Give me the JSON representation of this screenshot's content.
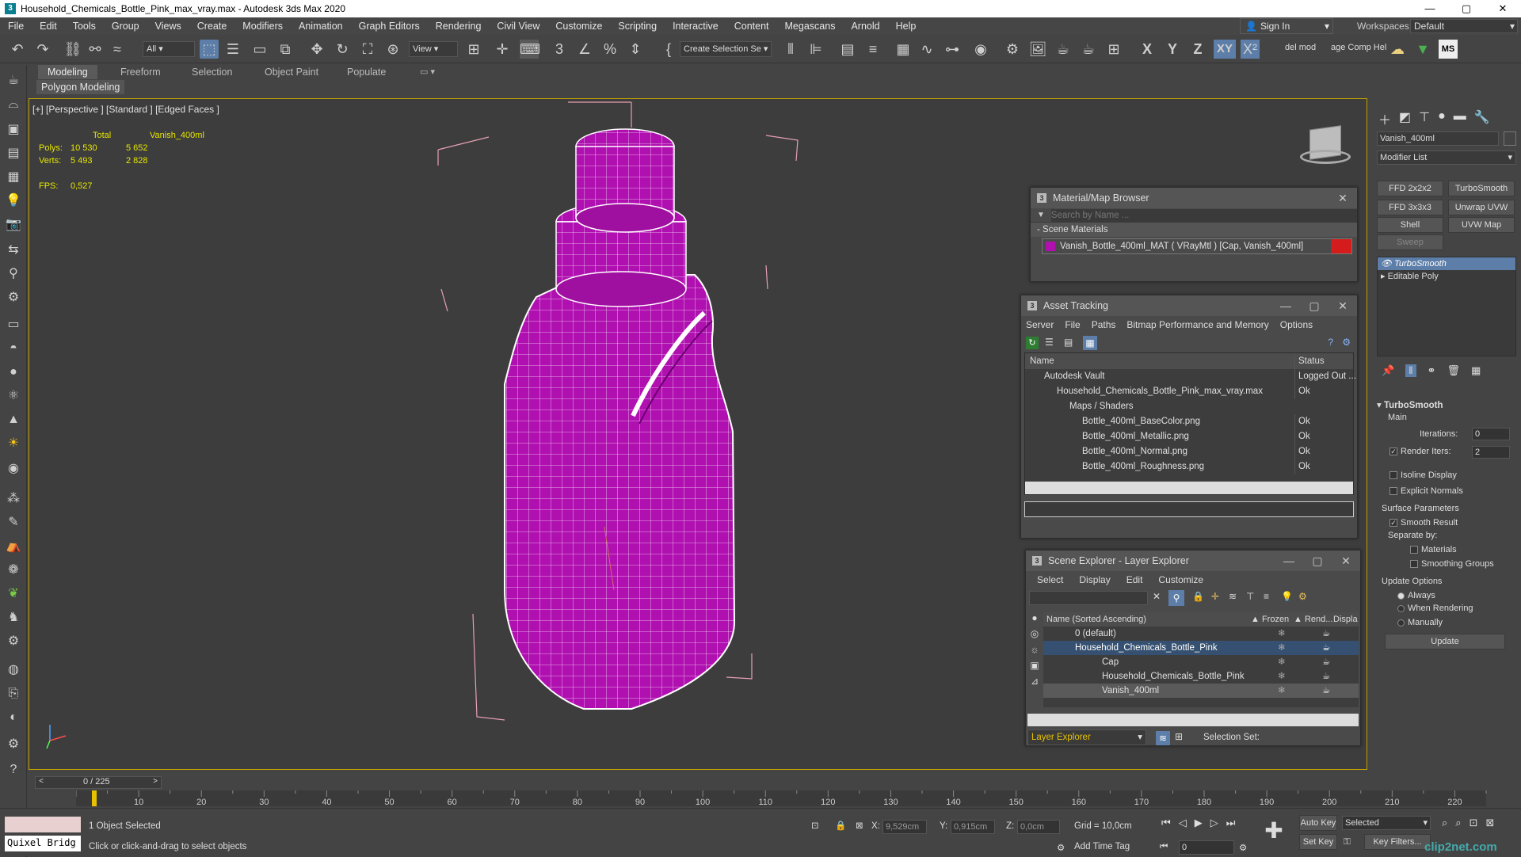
{
  "title_bar": {
    "title": "Household_Chemicals_Bottle_Pink_max_vray.max - Autodesk 3ds Max 2020",
    "minimize": "—",
    "maximize": "▢",
    "close": "✕"
  },
  "menu": {
    "items": [
      "File",
      "Edit",
      "Tools",
      "Group",
      "Views",
      "Create",
      "Modifiers",
      "Animation",
      "Graph Editors",
      "Rendering",
      "Civil View",
      "Customize",
      "Scripting",
      "Interactive",
      "Content",
      "Megascans",
      "Arnold",
      "Help"
    ],
    "sign_in": "Sign In",
    "workspaces_label": "Workspaces:",
    "workspaces_value": "Default"
  },
  "toolbar": {
    "filter_value": "All",
    "view_value": "View",
    "create_selection_set": "Create Selection Se",
    "axis_x": "X",
    "axis_y": "Y",
    "axis_z": "Z",
    "axis_xy": "XY",
    "del_mod": "del mod",
    "age_comp_help": "age Comp Hel",
    "ms": "MS"
  },
  "ribbon": {
    "tabs": [
      "Modeling",
      "Freeform",
      "Selection",
      "Object Paint",
      "Populate"
    ],
    "active_sub": "Polygon Modeling"
  },
  "viewport": {
    "label": "[+] [Perspective ] [Standard ] [Edged Faces ]",
    "stats": {
      "total_label": "Total",
      "object_label": "Vanish_400ml",
      "polys_label": "Polys:",
      "polys_total": "10 530",
      "polys_object": "5 652",
      "verts_label": "Verts:",
      "verts_total": "5 493",
      "verts_object": "2 828",
      "fps_label": "FPS:",
      "fps_value": "0,527"
    }
  },
  "material_browser": {
    "title": "Material/Map Browser",
    "search_placeholder": "Search by Name ...",
    "section": "- Scene Materials",
    "material_item": "Vanish_Bottle_400ml_MAT  ( VRayMtl ) [Cap, Vanish_400ml]"
  },
  "asset_tracking": {
    "title": "Asset Tracking",
    "menu": [
      "Server",
      "File",
      "Paths",
      "Bitmap Performance and Memory",
      "Options"
    ],
    "col_name": "Name",
    "col_status": "Status",
    "rows": [
      {
        "name": "Autodesk Vault",
        "status": "Logged Out ..."
      },
      {
        "name": "Household_Chemicals_Bottle_Pink_max_vray.max",
        "status": "Ok"
      },
      {
        "name": "Maps / Shaders",
        "status": ""
      },
      {
        "name": "Bottle_400ml_BaseColor.png",
        "status": "Ok"
      },
      {
        "name": "Bottle_400ml_Metallic.png",
        "status": "Ok"
      },
      {
        "name": "Bottle_400ml_Normal.png",
        "status": "Ok"
      },
      {
        "name": "Bottle_400ml_Roughness.png",
        "status": "Ok"
      }
    ]
  },
  "scene_explorer": {
    "title": "Scene Explorer - Layer Explorer",
    "menu": [
      "Select",
      "Display",
      "Edit",
      "Customize"
    ],
    "col_name": "Name (Sorted Ascending)",
    "col_frozen": "▲ Frozen",
    "col_render": "▲ Rend...",
    "col_display": "Displa",
    "rows": [
      {
        "name": "0 (default)"
      },
      {
        "name": "Household_Chemicals_Bottle_Pink"
      },
      {
        "name": "Cap"
      },
      {
        "name": "Household_Chemicals_Bottle_Pink"
      },
      {
        "name": "Vanish_400ml"
      }
    ],
    "footer_value": "Layer Explorer",
    "selection_set_label": "Selection Set:"
  },
  "command_panel": {
    "object_name": "Vanish_400ml",
    "modifier_list": "Modifier List",
    "buttons": [
      "FFD 2x2x2",
      "TurboSmooth",
      "FFD 3x3x3",
      "Unwrap UVW",
      "Shell",
      "UVW Map",
      "Sweep"
    ],
    "stack": [
      "TurboSmooth",
      "Editable Poly"
    ],
    "rollout_title": "TurboSmooth",
    "main_label": "Main",
    "iterations_label": "Iterations:",
    "iterations_value": "0",
    "render_iters_label": "Render Iters:",
    "render_iters_value": "2",
    "isoline_display": "Isoline Display",
    "explicit_normals": "Explicit Normals",
    "surface_params": "Surface Parameters",
    "smooth_result": "Smooth Result",
    "separate_by": "Separate by:",
    "materials": "Materials",
    "smoothing_groups": "Smoothing Groups",
    "update_options": "Update Options",
    "always": "Always",
    "when_rendering": "When Rendering",
    "manually": "Manually",
    "update_button": "Update"
  },
  "timeline": {
    "frame_counter": "0 / 225",
    "ticks": [
      "10",
      "20",
      "30",
      "40",
      "50",
      "60",
      "70",
      "80",
      "90",
      "100",
      "110",
      "120",
      "130",
      "140",
      "150",
      "160",
      "170",
      "180",
      "190",
      "200",
      "210",
      "220"
    ]
  },
  "status_bar": {
    "quixel": "Quixel Bridg",
    "selected": "1 Object Selected",
    "prompt": "Click or click-and-drag to select objects",
    "x_label": "X:",
    "x_value": "9,529cm",
    "y_label": "Y:",
    "y_value": "0,915cm",
    "z_label": "Z:",
    "z_value": "0,0cm",
    "grid": "Grid = 10,0cm",
    "add_time_tag": "Add Time Tag",
    "auto_key": "Auto Key",
    "selected_value": "Selected",
    "set_key": "Set Key",
    "key_filters": "Key Filters...",
    "frame_value": "0",
    "watermark": "clip2net.com"
  }
}
